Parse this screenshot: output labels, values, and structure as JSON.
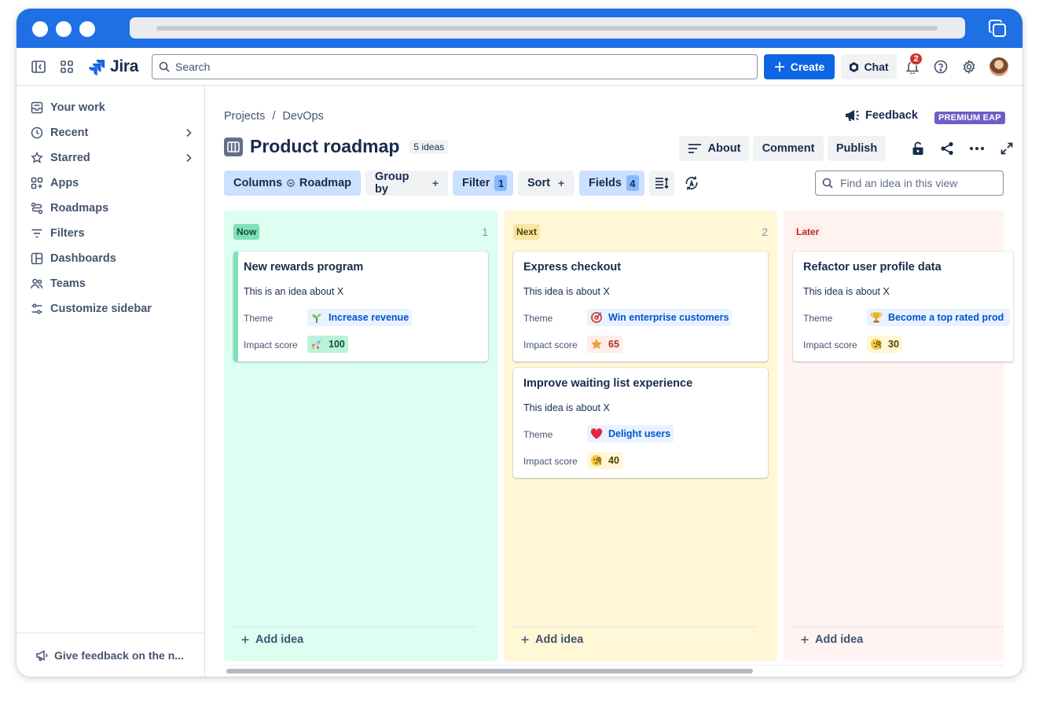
{
  "topnav": {
    "app_name": "Jira",
    "search_placeholder": "Search",
    "create_label": "Create",
    "chat_label": "Chat",
    "notification_count": "2"
  },
  "sidebar": {
    "items": [
      {
        "label": "Your work",
        "icon": "inbox-icon"
      },
      {
        "label": "Recent",
        "icon": "clock-icon",
        "expandable": true
      },
      {
        "label": "Starred",
        "icon": "star-icon",
        "expandable": true
      },
      {
        "label": "Apps",
        "icon": "apps-icon"
      },
      {
        "label": "Roadmaps",
        "icon": "roadmap-icon"
      },
      {
        "label": "Filters",
        "icon": "filter-icon"
      },
      {
        "label": "Dashboards",
        "icon": "dashboard-icon"
      },
      {
        "label": "Teams",
        "icon": "teams-icon"
      },
      {
        "label": "Customize sidebar",
        "icon": "customize-icon"
      }
    ],
    "footer_label": "Give feedback on the n..."
  },
  "breadcrumb": {
    "projects": "Projects",
    "separator": "/",
    "project": "DevOps"
  },
  "header": {
    "feedback_label": "Feedback",
    "premium_badge": "PREMIUM EAP",
    "title": "Product roadmap",
    "ideas_count": "5 ideas",
    "about_label": "About",
    "comment_label": "Comment",
    "publish_label": "Publish"
  },
  "toolbar": {
    "columns_label": "Columns",
    "columns_value": "Roadmap",
    "groupby_label": "Group by",
    "filter_label": "Filter",
    "filter_count": "1",
    "sort_label": "Sort",
    "fields_label": "Fields",
    "fields_count": "4",
    "find_placeholder": "Find an idea in this view"
  },
  "board": {
    "field_theme": "Theme",
    "field_impact": "Impact score",
    "add_idea_label": "Add idea",
    "columns": [
      {
        "label": "Now",
        "count": "1",
        "bg": "#dcfff1",
        "label_bg": "#7ee2b8",
        "label_color": "#164b35",
        "cards": [
          {
            "title": "New rewards program",
            "desc": "This is an idea about X",
            "theme": "Increase revenue",
            "theme_icon": "sprout-icon",
            "impact": "100",
            "impact_icon": "rocket-icon",
            "impact_bg": "#baf3db",
            "impact_color": "#164b35"
          }
        ]
      },
      {
        "label": "Next",
        "count": "2",
        "bg": "#fff7d6",
        "label_bg": "#f8e6a0",
        "label_color": "#533f04",
        "cards": [
          {
            "title": "Express checkout",
            "desc": "This idea is about X",
            "theme": "Win enterprise customers",
            "theme_icon": "target-icon",
            "impact": "65",
            "impact_icon": "star-icon",
            "impact_bg": "#ffeceb",
            "impact_color": "#ae2e24"
          },
          {
            "title": "Improve waiting list experience",
            "desc": "This idea is about X",
            "theme": "Delight users",
            "theme_icon": "heart-icon",
            "impact": "40",
            "impact_icon": "monocle-face-icon",
            "impact_bg": "#fff7d6",
            "impact_color": "#533f04"
          }
        ]
      },
      {
        "label": "Later",
        "count": "",
        "bg": "#fff4f1",
        "label_bg": "#ffeceb",
        "label_color": "#ae2e24",
        "cards": [
          {
            "title": "Refactor user profile data",
            "desc": "This idea is about X",
            "theme": "Become a top rated prod",
            "theme_icon": "trophy-icon",
            "impact": "30",
            "impact_icon": "monocle-face-icon",
            "impact_bg": "#fff7d6",
            "impact_color": "#533f04"
          }
        ]
      }
    ]
  }
}
